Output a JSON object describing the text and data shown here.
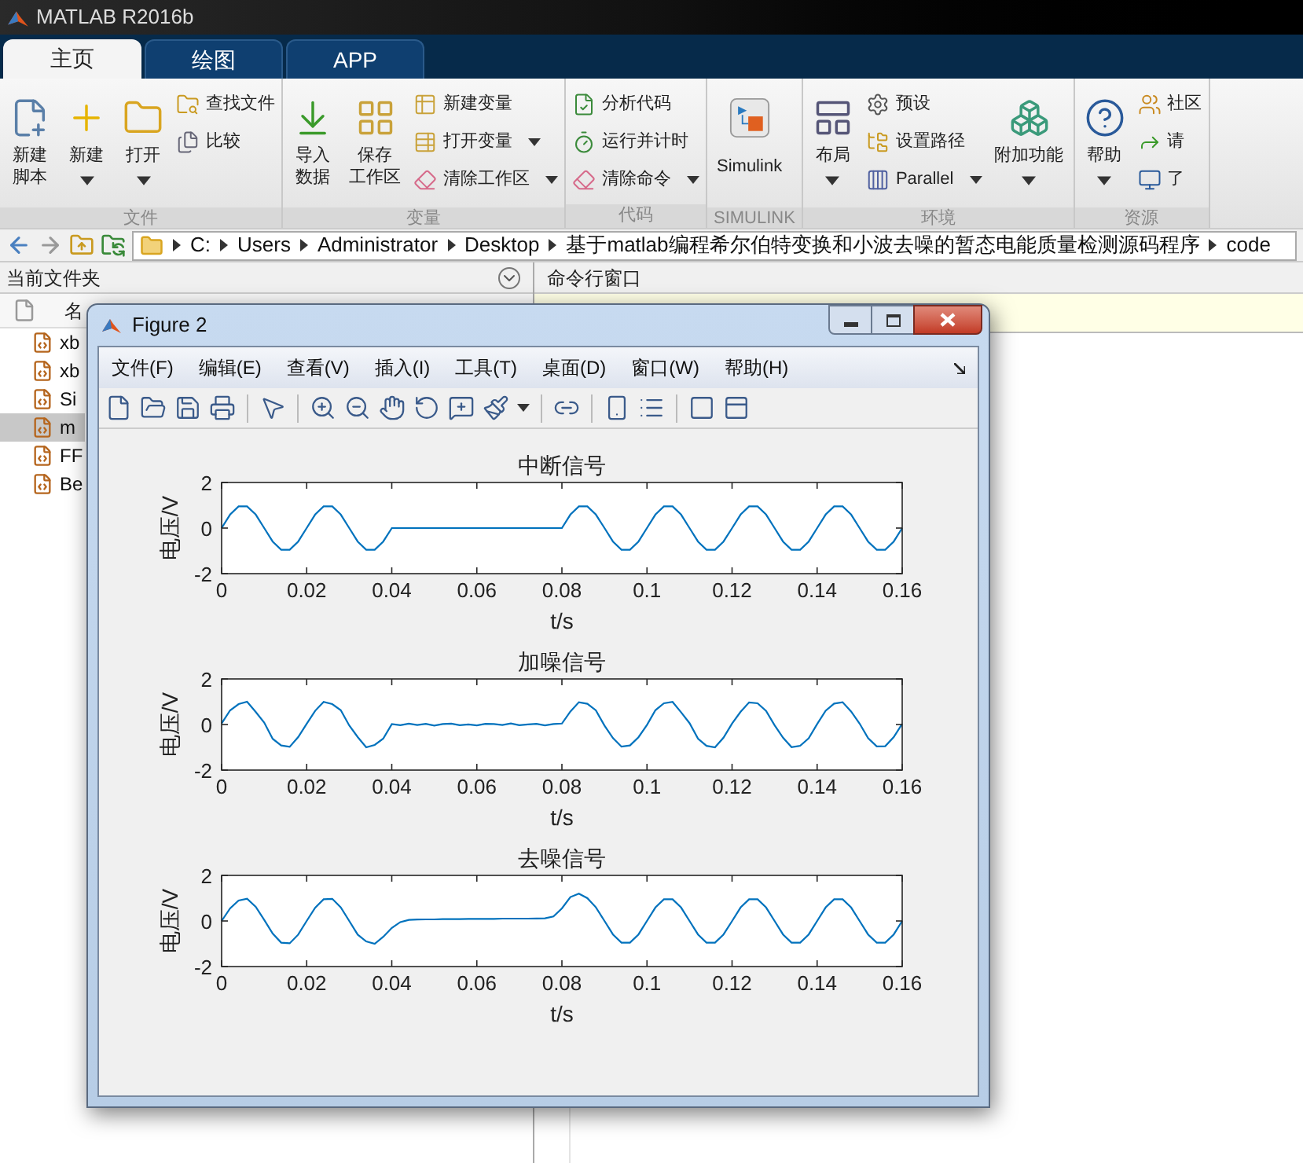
{
  "window": {
    "title": "MATLAB R2016b"
  },
  "tabs": [
    {
      "label": "主页",
      "selected": true
    },
    {
      "label": "绘图",
      "selected": false
    },
    {
      "label": "APP",
      "selected": false
    }
  ],
  "ribbon": {
    "groups": [
      {
        "label": "文件",
        "items": [
          {
            "kind": "large",
            "lines": [
              "新建",
              "脚本"
            ],
            "dropdown": false
          },
          {
            "kind": "large",
            "lines": [
              "新建"
            ],
            "dropdown": true
          },
          {
            "kind": "large",
            "lines": [
              "打开"
            ],
            "dropdown": true
          },
          {
            "kind": "small",
            "label": "查找文件",
            "dropdown": false
          },
          {
            "kind": "small",
            "label": "比较",
            "dropdown": false
          }
        ]
      },
      {
        "label": "变量",
        "items": [
          {
            "kind": "large",
            "lines": [
              "导入",
              "数据"
            ],
            "dropdown": false
          },
          {
            "kind": "large",
            "lines": [
              "保存",
              "工作区"
            ],
            "dropdown": false
          },
          {
            "kind": "small",
            "label": "新建变量",
            "dropdown": false
          },
          {
            "kind": "small",
            "label": "打开变量",
            "dropdown": true
          },
          {
            "kind": "small",
            "label": "清除工作区",
            "dropdown": true
          }
        ]
      },
      {
        "label": "代码",
        "items": [
          {
            "kind": "small",
            "label": "分析代码",
            "dropdown": false
          },
          {
            "kind": "small",
            "label": "运行并计时",
            "dropdown": false
          },
          {
            "kind": "small",
            "label": "清除命令",
            "dropdown": true
          }
        ]
      },
      {
        "label": "SIMULINK",
        "items": [
          {
            "kind": "large",
            "lines": [
              "Simulink"
            ],
            "dropdown": false
          }
        ]
      },
      {
        "label": "环境",
        "items": [
          {
            "kind": "large",
            "lines": [
              "布局"
            ],
            "dropdown": true
          },
          {
            "kind": "small",
            "label": "预设",
            "dropdown": false
          },
          {
            "kind": "small",
            "label": "设置路径",
            "dropdown": false
          },
          {
            "kind": "small",
            "label": "Parallel",
            "dropdown": true
          },
          {
            "kind": "large",
            "lines": [
              "附加功能"
            ],
            "dropdown": true
          }
        ]
      },
      {
        "label": "资源",
        "items": [
          {
            "kind": "large",
            "lines": [
              "帮助"
            ],
            "dropdown": true
          },
          {
            "kind": "small",
            "label": "社区",
            "dropdown": false
          },
          {
            "kind": "small",
            "label": "请",
            "dropdown": false
          },
          {
            "kind": "small",
            "label": "了",
            "dropdown": false
          }
        ]
      }
    ]
  },
  "address_bar": {
    "segments": [
      "C:",
      "Users",
      "Administrator",
      "Desktop",
      "基于matlab编程希尔伯特变换和小波去噪的暂态电能质量检测源码程序",
      "code"
    ]
  },
  "current_folder": {
    "title": "当前文件夹",
    "column_header": "名",
    "files": [
      {
        "name": "xb",
        "selected": false
      },
      {
        "name": "xb",
        "selected": false
      },
      {
        "name": "Si",
        "selected": false
      },
      {
        "name": "m",
        "selected": true
      },
      {
        "name": "FF",
        "selected": false
      },
      {
        "name": "Be",
        "selected": false
      }
    ]
  },
  "command_window": {
    "title": "命令行窗口"
  },
  "figure": {
    "title": "Figure 2",
    "menu": [
      "文件(F)",
      "编辑(E)",
      "查看(V)",
      "插入(I)",
      "工具(T)",
      "桌面(D)",
      "窗口(W)",
      "帮助(H)"
    ],
    "plots": [
      {
        "chart_data": {
          "type": "line",
          "title": "中断信号",
          "xlabel": "t/s",
          "ylabel": "电压/V",
          "xlim": [
            0,
            0.16
          ],
          "ylim": [
            -2,
            2
          ],
          "xticks": [
            0,
            0.02,
            0.04,
            0.06,
            0.08,
            0.1,
            0.12,
            0.14,
            0.16
          ],
          "yticks": [
            -2,
            0,
            2
          ],
          "x": [
            0,
            0.002,
            0.004,
            0.006,
            0.008,
            0.01,
            0.012,
            0.014,
            0.016,
            0.018,
            0.02,
            0.022,
            0.024,
            0.026,
            0.028,
            0.03,
            0.032,
            0.034,
            0.036,
            0.038,
            0.04,
            0.042,
            0.044,
            0.046,
            0.048,
            0.05,
            0.052,
            0.054,
            0.056,
            0.058,
            0.06,
            0.062,
            0.064,
            0.066,
            0.068,
            0.07,
            0.072,
            0.074,
            0.076,
            0.078,
            0.08,
            0.082,
            0.084,
            0.086,
            0.088,
            0.09,
            0.092,
            0.094,
            0.096,
            0.098,
            0.1,
            0.102,
            0.104,
            0.106,
            0.108,
            0.11,
            0.112,
            0.114,
            0.116,
            0.118,
            0.12,
            0.122,
            0.124,
            0.126,
            0.128,
            0.13,
            0.132,
            0.134,
            0.136,
            0.138,
            0.14,
            0.142,
            0.144,
            0.146,
            0.148,
            0.15,
            0.152,
            0.154,
            0.156,
            0.158,
            0.16
          ],
          "series": [
            {
              "color": "#0072bd",
              "values": [
                0,
                0.59,
                0.95,
                0.95,
                0.59,
                0,
                -0.59,
                -0.95,
                -0.95,
                -0.59,
                0,
                0.59,
                0.95,
                0.95,
                0.59,
                0,
                -0.59,
                -0.95,
                -0.95,
                -0.59,
                0,
                0,
                0,
                0,
                0,
                0,
                0,
                0,
                0,
                0,
                0,
                0,
                0,
                0,
                0,
                0,
                0,
                0,
                0,
                0,
                0,
                0.59,
                0.95,
                0.95,
                0.59,
                0,
                -0.59,
                -0.95,
                -0.95,
                -0.59,
                0,
                0.59,
                0.95,
                0.95,
                0.59,
                0,
                -0.59,
                -0.95,
                -0.95,
                -0.59,
                0,
                0.59,
                0.95,
                0.95,
                0.59,
                0,
                -0.59,
                -0.95,
                -0.95,
                -0.59,
                0,
                0.59,
                0.95,
                0.95,
                0.59,
                0,
                -0.59,
                -0.95,
                -0.95,
                -0.59,
                0
              ]
            }
          ]
        }
      },
      {
        "chart_data": {
          "type": "line",
          "title": "加噪信号",
          "xlabel": "t/s",
          "ylabel": "电压/V",
          "xlim": [
            0,
            0.16
          ],
          "ylim": [
            -2,
            2
          ],
          "xticks": [
            0,
            0.02,
            0.04,
            0.06,
            0.08,
            0.1,
            0.12,
            0.14,
            0.16
          ],
          "yticks": [
            -2,
            0,
            2
          ],
          "x": [
            0,
            0.002,
            0.004,
            0.006,
            0.008,
            0.01,
            0.012,
            0.014,
            0.016,
            0.018,
            0.02,
            0.022,
            0.024,
            0.026,
            0.028,
            0.03,
            0.032,
            0.034,
            0.036,
            0.038,
            0.04,
            0.042,
            0.044,
            0.046,
            0.048,
            0.05,
            0.052,
            0.054,
            0.056,
            0.058,
            0.06,
            0.062,
            0.064,
            0.066,
            0.068,
            0.07,
            0.072,
            0.074,
            0.076,
            0.078,
            0.08,
            0.082,
            0.084,
            0.086,
            0.088,
            0.09,
            0.092,
            0.094,
            0.096,
            0.098,
            0.1,
            0.102,
            0.104,
            0.106,
            0.108,
            0.11,
            0.112,
            0.114,
            0.116,
            0.118,
            0.12,
            0.122,
            0.124,
            0.126,
            0.128,
            0.13,
            0.132,
            0.134,
            0.136,
            0.138,
            0.14,
            0.142,
            0.144,
            0.146,
            0.148,
            0.15,
            0.152,
            0.154,
            0.156,
            0.158,
            0.16
          ],
          "series": [
            {
              "color": "#0072bd",
              "values": [
                0.05,
                0.62,
                0.9,
                1.0,
                0.55,
                0.08,
                -0.63,
                -0.92,
                -0.98,
                -0.55,
                0.03,
                0.6,
                0.99,
                0.9,
                0.63,
                -0.04,
                -0.55,
                -1.0,
                -0.9,
                -0.62,
                0.02,
                -0.03,
                0.04,
                -0.02,
                0.03,
                -0.05,
                0.02,
                0.04,
                -0.03,
                0.01,
                -0.04,
                0.03,
                0.02,
                -0.02,
                0.05,
                -0.03,
                0.01,
                0.03,
                -0.04,
                0.02,
                0.04,
                0.57,
                0.98,
                0.91,
                0.62,
                -0.05,
                -0.6,
                -0.97,
                -0.92,
                -0.56,
                -0.02,
                0.63,
                0.93,
                0.99,
                0.54,
                0.06,
                -0.62,
                -0.94,
                -1.0,
                -0.58,
                0.05,
                0.56,
                0.97,
                0.93,
                0.6,
                -0.03,
                -0.58,
                -0.99,
                -0.93,
                -0.61,
                0.02,
                0.61,
                0.92,
                0.98,
                0.57,
                0.04,
                -0.59,
                -0.96,
                -0.95,
                -0.55,
                0.03
              ]
            }
          ]
        }
      },
      {
        "chart_data": {
          "type": "line",
          "title": "去噪信号",
          "xlabel": "t/s",
          "ylabel": "电压/V",
          "xlim": [
            0,
            0.16
          ],
          "ylim": [
            -2,
            2
          ],
          "xticks": [
            0,
            0.02,
            0.04,
            0.06,
            0.08,
            0.1,
            0.12,
            0.14,
            0.16
          ],
          "yticks": [
            -2,
            0,
            2
          ],
          "x": [
            0,
            0.002,
            0.004,
            0.006,
            0.008,
            0.01,
            0.012,
            0.014,
            0.016,
            0.018,
            0.02,
            0.022,
            0.024,
            0.026,
            0.028,
            0.03,
            0.032,
            0.034,
            0.036,
            0.038,
            0.04,
            0.042,
            0.044,
            0.046,
            0.048,
            0.05,
            0.052,
            0.054,
            0.056,
            0.058,
            0.06,
            0.062,
            0.064,
            0.066,
            0.068,
            0.07,
            0.072,
            0.074,
            0.076,
            0.078,
            0.08,
            0.082,
            0.084,
            0.086,
            0.088,
            0.09,
            0.092,
            0.094,
            0.096,
            0.098,
            0.1,
            0.102,
            0.104,
            0.106,
            0.108,
            0.11,
            0.112,
            0.114,
            0.116,
            0.118,
            0.12,
            0.122,
            0.124,
            0.126,
            0.128,
            0.13,
            0.132,
            0.134,
            0.136,
            0.138,
            0.14,
            0.142,
            0.144,
            0.146,
            0.148,
            0.15,
            0.152,
            0.154,
            0.156,
            0.158,
            0.16
          ],
          "series": [
            {
              "color": "#0072bd",
              "values": [
                0,
                0.55,
                0.9,
                0.98,
                0.62,
                0.05,
                -0.55,
                -0.95,
                -0.98,
                -0.6,
                0,
                0.58,
                0.95,
                0.97,
                0.6,
                0,
                -0.6,
                -0.9,
                -1.0,
                -0.7,
                -0.3,
                -0.05,
                0.05,
                0.06,
                0.07,
                0.07,
                0.08,
                0.08,
                0.08,
                0.09,
                0.09,
                0.09,
                0.09,
                0.1,
                0.1,
                0.1,
                0.1,
                0.11,
                0.12,
                0.2,
                0.55,
                1.05,
                1.2,
                1.0,
                0.6,
                0,
                -0.59,
                -0.95,
                -0.95,
                -0.59,
                0,
                0.59,
                0.95,
                0.95,
                0.59,
                0,
                -0.59,
                -0.95,
                -0.95,
                -0.59,
                0,
                0.59,
                0.95,
                0.95,
                0.59,
                0,
                -0.59,
                -0.95,
                -0.95,
                -0.59,
                0,
                0.59,
                0.95,
                0.95,
                0.59,
                0,
                -0.59,
                -0.95,
                -0.95,
                -0.59,
                0
              ]
            }
          ]
        }
      }
    ]
  }
}
